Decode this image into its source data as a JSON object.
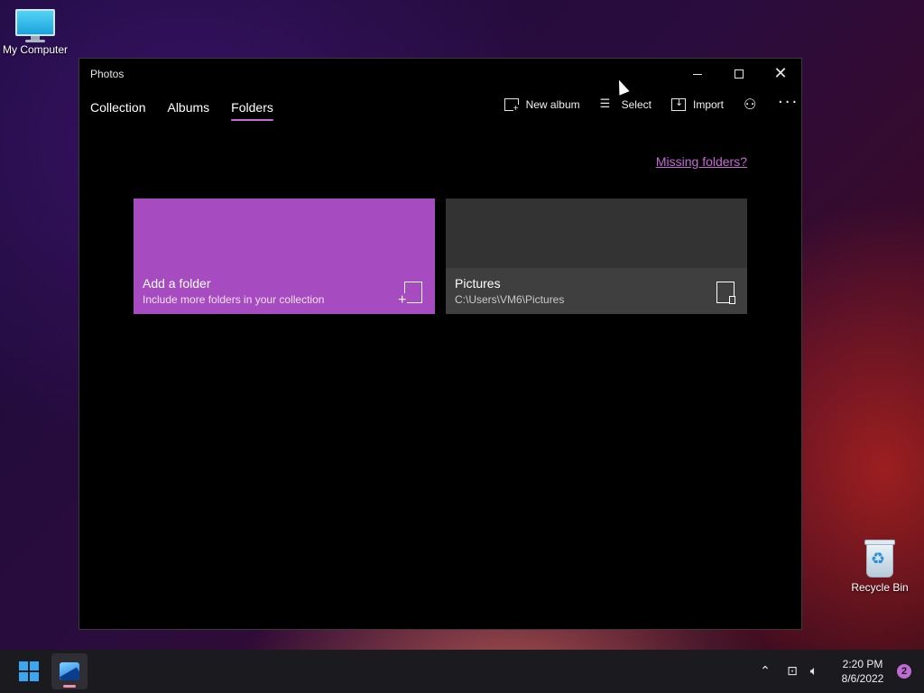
{
  "desktop": {
    "icons": [
      {
        "label": "My Computer",
        "icon": "monitor-icon"
      },
      {
        "label": "Recycle Bin",
        "icon": "recycle-bin-icon"
      }
    ]
  },
  "window": {
    "title": "Photos",
    "controls": {
      "minimize": "minimize-icon",
      "maximize": "maximize-icon",
      "close": "close-icon"
    }
  },
  "tabs": [
    {
      "label": "Collection",
      "active": false
    },
    {
      "label": "Albums",
      "active": false
    },
    {
      "label": "Folders",
      "active": true
    }
  ],
  "toolbar": {
    "new_album": "New album",
    "select": "Select",
    "import": "Import",
    "account_icon": "person-add-icon",
    "more_icon": "more-icon"
  },
  "missing_link": "Missing folders?",
  "folders": [
    {
      "title": "Add a folder",
      "subtitle": "Include more folders in your collection",
      "color": "#a64cc0"
    },
    {
      "title": "Pictures",
      "subtitle": "C:\\Users\\VM6\\Pictures",
      "color": "#333333"
    }
  ],
  "taskbar": {
    "time": "2:20 PM",
    "date": "8/6/2022",
    "notification_count": "2",
    "tray_icons": [
      "chevron-up-icon",
      "network-icon",
      "volume-icon"
    ]
  },
  "colors": {
    "accent": "#c56ad6",
    "add_tile": "#a64cc0",
    "window_bg": "#000000"
  }
}
